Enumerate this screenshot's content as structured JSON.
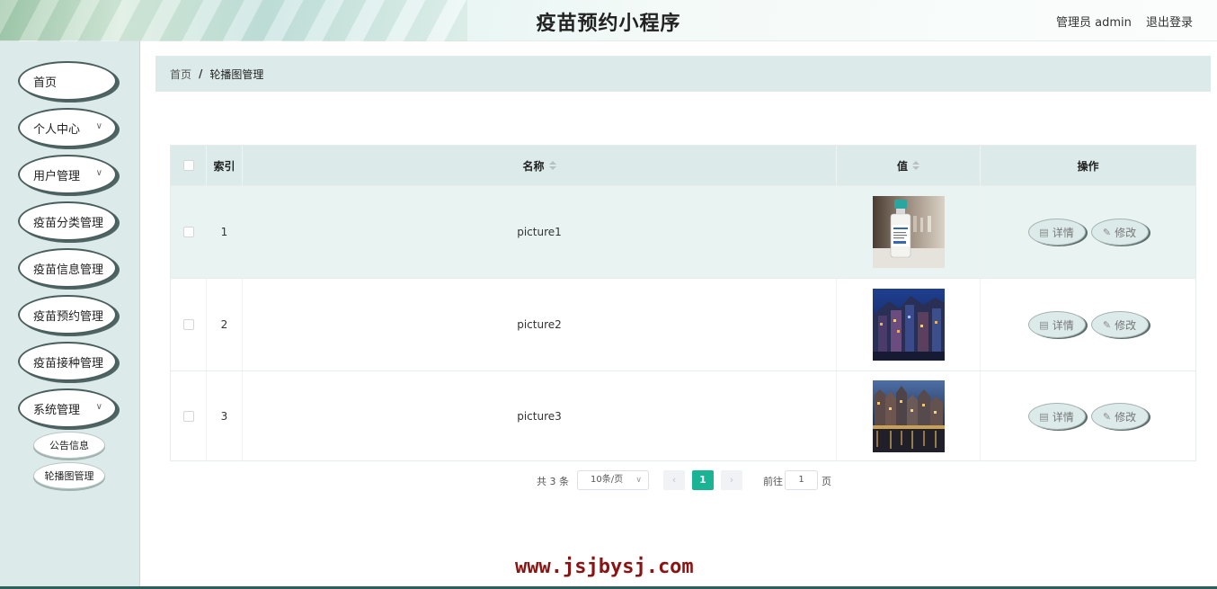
{
  "header": {
    "title": "疫苗预约小程序",
    "admin_label": "管理员 admin",
    "logout": "退出登录"
  },
  "sidebar": {
    "items": [
      {
        "label": "首页",
        "has_chevron": false
      },
      {
        "label": "个人中心",
        "has_chevron": true
      },
      {
        "label": "用户管理",
        "has_chevron": true
      },
      {
        "label": "疫苗分类管理",
        "has_chevron": false
      },
      {
        "label": "疫苗信息管理",
        "has_chevron": false
      },
      {
        "label": "疫苗预约管理",
        "has_chevron": false
      },
      {
        "label": "疫苗接种管理",
        "has_chevron": false
      },
      {
        "label": "系统管理",
        "has_chevron": true
      }
    ],
    "subitems": [
      {
        "label": "公告信息"
      },
      {
        "label": "轮播图管理"
      }
    ]
  },
  "breadcrumb": {
    "home": "首页",
    "separator": "/",
    "current": "轮播图管理"
  },
  "table": {
    "columns": {
      "index": "索引",
      "name": "名称",
      "value": "值",
      "action": "操作"
    },
    "rows": [
      {
        "index": "1",
        "name": "picture1",
        "image": "vaccine-vial-photo"
      },
      {
        "index": "2",
        "name": "picture2",
        "image": "city-night-blur-photo"
      },
      {
        "index": "3",
        "name": "picture3",
        "image": "canal-houses-night-photo"
      }
    ],
    "actions": {
      "detail": "详情",
      "edit": "修改"
    }
  },
  "pagination": {
    "total": "共 3 条",
    "page_size": "10条/页",
    "prev": "‹",
    "next": "›",
    "current_page": "1",
    "goto_label": "前往",
    "goto_value": "1",
    "goto_unit": "页"
  },
  "watermark": "www.jsjbysj.com",
  "colors": {
    "accent": "#1ab394",
    "sidebar_bg": "#dcebea",
    "watermark": "#8a1313"
  }
}
